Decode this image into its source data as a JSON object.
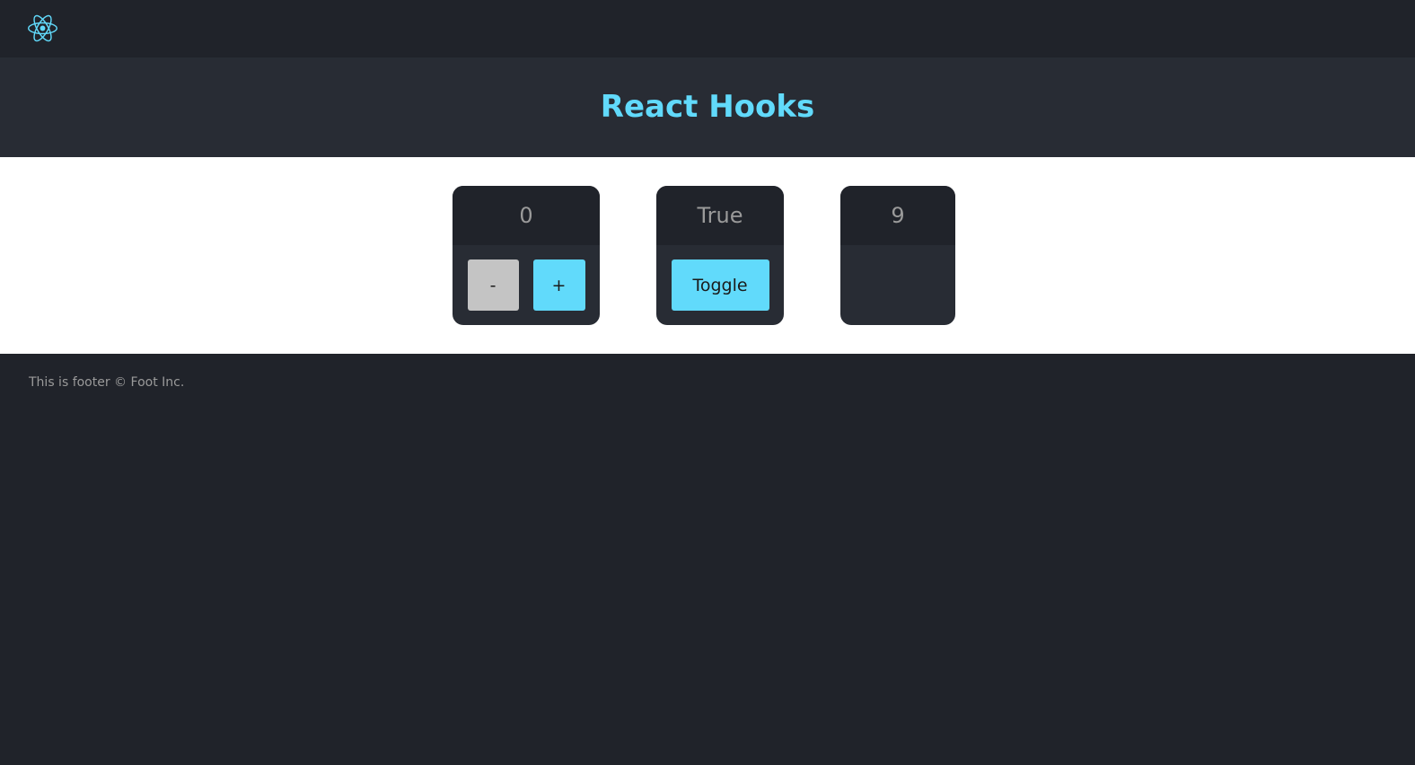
{
  "header": {
    "logo_icon": "react-atom-icon",
    "title": "React Hooks"
  },
  "cards": {
    "counter": {
      "value": "0",
      "decrement_label": "-",
      "increment_label": "+"
    },
    "toggle": {
      "value": "True",
      "button_label": "Toggle"
    },
    "number": {
      "value": "9"
    }
  },
  "footer": {
    "text": "This is footer © Foot Inc."
  },
  "colors": {
    "accent": "#61dafb",
    "dark_bg": "#20232a",
    "panel_bg": "#282c34",
    "muted_button": "#c4c4c4",
    "muted_text": "#9a9a9a"
  }
}
